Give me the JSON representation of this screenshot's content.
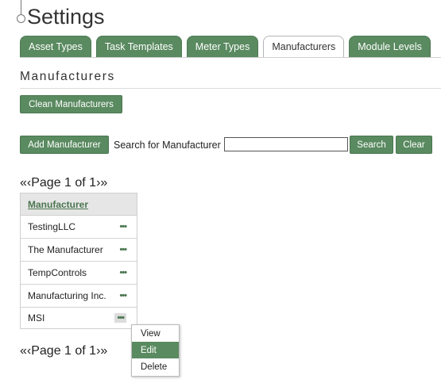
{
  "page": {
    "title": "Settings"
  },
  "tabs": [
    {
      "label": "Asset Types",
      "active": false
    },
    {
      "label": "Task Templates",
      "active": false
    },
    {
      "label": "Meter Types",
      "active": false
    },
    {
      "label": "Manufacturers",
      "active": true
    },
    {
      "label": "Module Levels",
      "active": false
    }
  ],
  "section": {
    "title": "Manufacturers"
  },
  "buttons": {
    "clean": "Clean Manufacturers",
    "add": "Add Manufacturer",
    "search": "Search",
    "clear": "Clear"
  },
  "search": {
    "label": "Search for Manufacturer :",
    "value": ""
  },
  "pager": {
    "first": "«",
    "prev": "‹",
    "text": "Page 1 of 1",
    "next": "›",
    "last": "»"
  },
  "table": {
    "header": "Manufacturer",
    "rows": [
      {
        "name": "TestingLLC",
        "action": "•••"
      },
      {
        "name": "The Manufacturer",
        "action": "•••"
      },
      {
        "name": "TempControls",
        "action": "•••"
      },
      {
        "name": "Manufacturing Inc.",
        "action": "•••"
      },
      {
        "name": "MSI",
        "action": "•••"
      }
    ]
  },
  "context_menu": {
    "items": [
      {
        "label": "View",
        "selected": false
      },
      {
        "label": "Edit",
        "selected": true
      },
      {
        "label": "Delete",
        "selected": false
      }
    ]
  },
  "colors": {
    "accent": "#5a8a60",
    "accent_border": "#4a7650"
  }
}
